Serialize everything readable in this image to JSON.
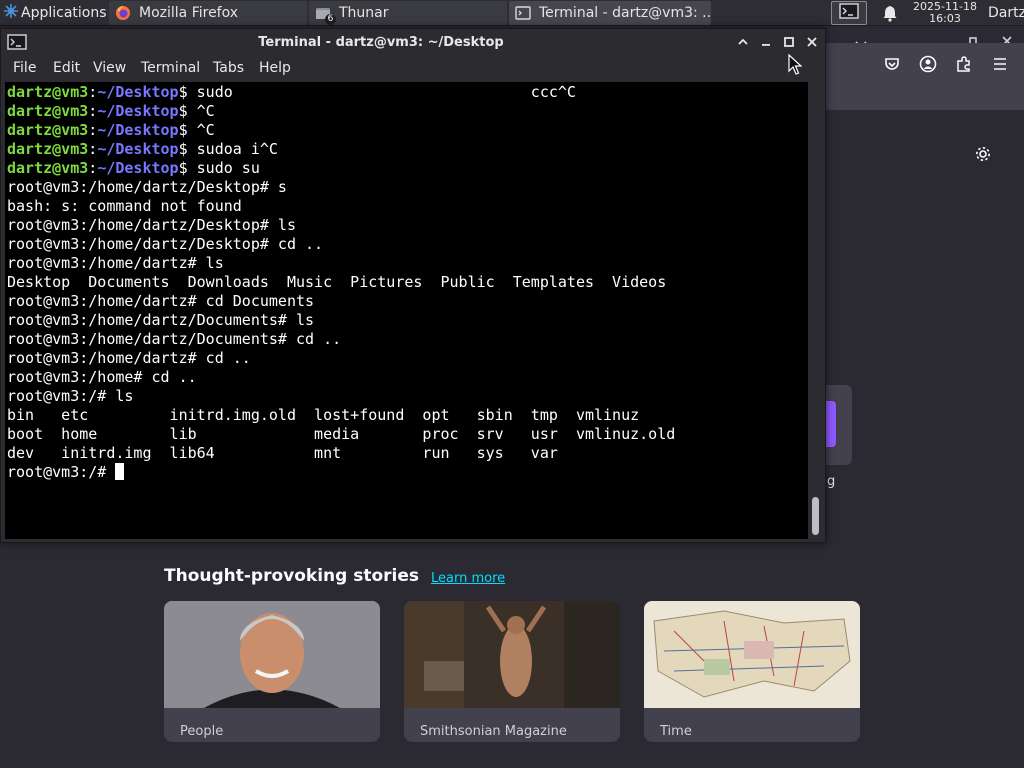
{
  "panel": {
    "applications_label": "Applications",
    "tasks": [
      {
        "label": "Mozilla Firefox",
        "icon": "firefox-icon"
      },
      {
        "label": "Thunar",
        "icon": "folder-icon",
        "badge": "6"
      },
      {
        "label": "Terminal - dartz@vm3: ...",
        "icon": "terminal-icon"
      }
    ],
    "clock_date": "2025-11-18",
    "clock_time": "16:03",
    "user": "Dartz"
  },
  "terminal": {
    "title": "Terminal - dartz@vm3: ~/Desktop",
    "menu": [
      "File",
      "Edit",
      "View",
      "Terminal",
      "Tabs",
      "Help"
    ],
    "lines": [
      {
        "user": "dartz@vm3",
        "path": "~/Desktop",
        "cmd": "$ sudo                                 ccc^C"
      },
      {
        "user": "dartz@vm3",
        "path": "~/Desktop",
        "cmd": "$ ^C"
      },
      {
        "user": "dartz@vm3",
        "path": "~/Desktop",
        "cmd": "$ ^C"
      },
      {
        "user": "dartz@vm3",
        "path": "~/Desktop",
        "cmd": "$ sudoa i^C"
      },
      {
        "user": "dartz@vm3",
        "path": "~/Desktop",
        "cmd": "$ sudo su"
      },
      {
        "text": "root@vm3:/home/dartz/Desktop# s"
      },
      {
        "text": "bash: s: command not found"
      },
      {
        "text": "root@vm3:/home/dartz/Desktop# ls"
      },
      {
        "text": "root@vm3:/home/dartz/Desktop# cd .."
      },
      {
        "text": "root@vm3:/home/dartz# ls"
      },
      {
        "text": "Desktop  Documents  Downloads  Music  Pictures  Public  Templates  Videos"
      },
      {
        "text": "root@vm3:/home/dartz# cd Documents"
      },
      {
        "text": "root@vm3:/home/dartz/Documents# ls"
      },
      {
        "text": "root@vm3:/home/dartz/Documents# cd .."
      },
      {
        "text": "root@vm3:/home/dartz# cd .."
      },
      {
        "text": "root@vm3:/home# cd .."
      },
      {
        "text": "root@vm3:/# ls"
      },
      {
        "text": "bin   etc         initrd.img.old  lost+found  opt   sbin  tmp  vmlinuz"
      },
      {
        "text": "boot  home        lib             media       proc  srv   usr  vmlinuz.old"
      },
      {
        "text": "dev   initrd.img  lib64           mnt         run   sys   var"
      },
      {
        "text": "root@vm3:/# ",
        "cursor": true
      }
    ]
  },
  "firefox": {
    "fragment_label": "g",
    "stories_title": "Thought-provoking stories",
    "learn_more": "Learn more",
    "stories": [
      {
        "source": "People"
      },
      {
        "source": "Smithsonian Magazine"
      },
      {
        "source": "Time"
      }
    ]
  },
  "colors": {
    "prompt_user": "#7eda3c",
    "prompt_path": "#7777ff",
    "terminal_bg": "#000000",
    "firefox_bg": "#2b2a33",
    "accent_link": "#00ddff"
  }
}
